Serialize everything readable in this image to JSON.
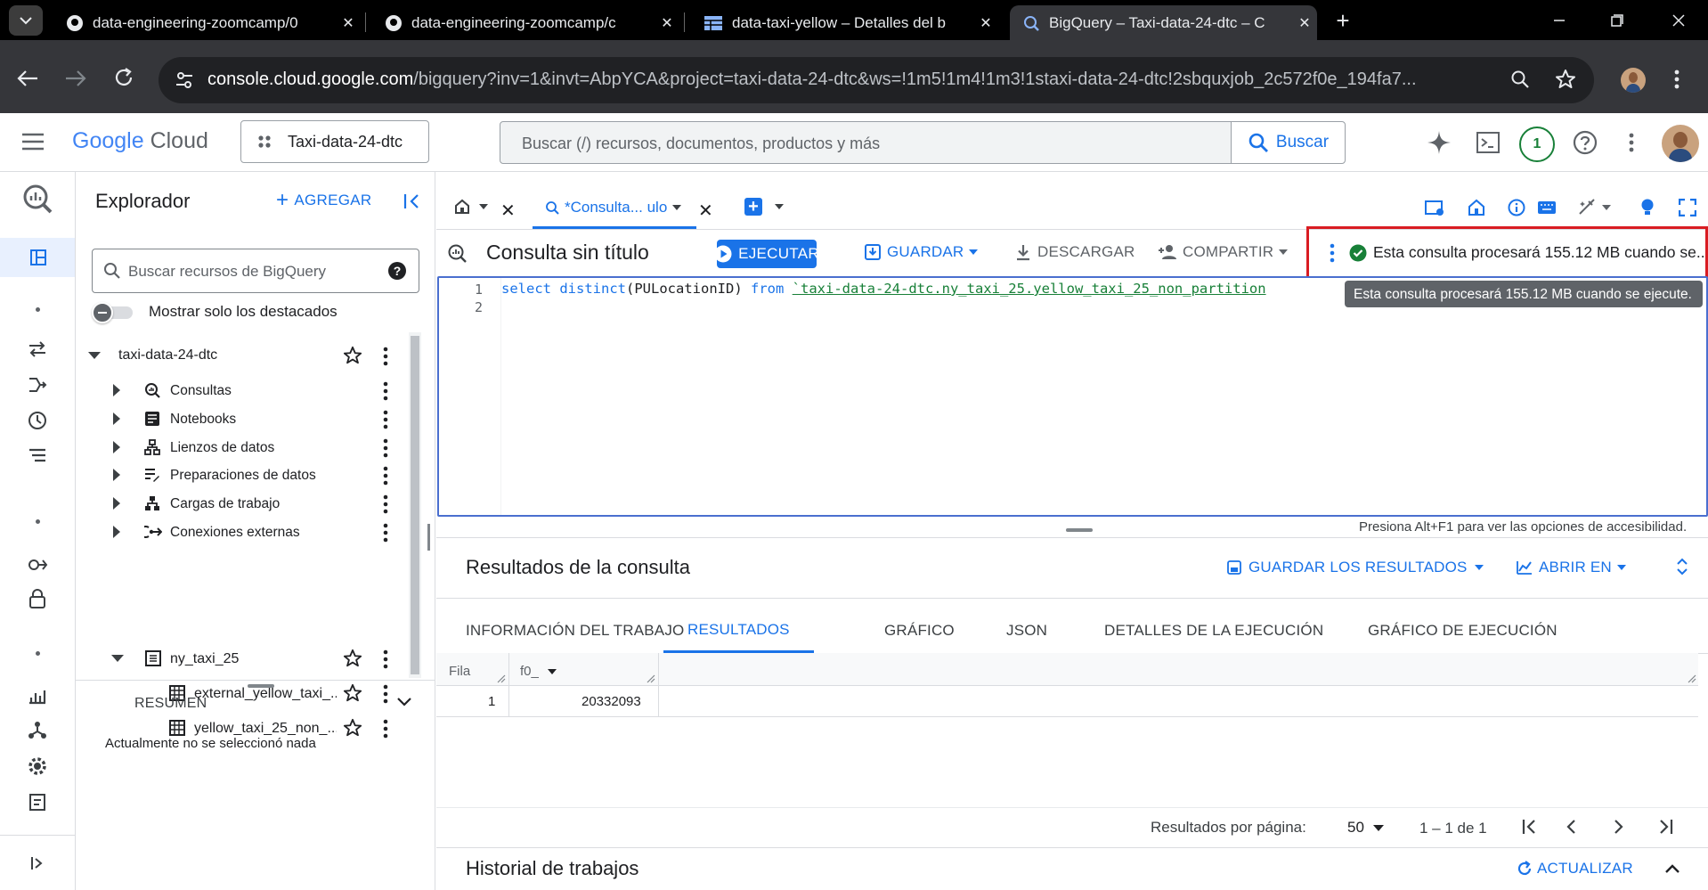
{
  "browser": {
    "tabs": [
      {
        "title": "data-engineering-zoomcamp/0",
        "icon": "github-icon"
      },
      {
        "title": "data-engineering-zoomcamp/c",
        "icon": "github-icon"
      },
      {
        "title": "data-taxi-yellow – Detalles del b",
        "icon": "table-icon"
      },
      {
        "title": "BigQuery – Taxi-data-24-dtc – C",
        "icon": "bigquery-icon",
        "active": true
      }
    ],
    "url_host": "console.cloud.google.com",
    "url_path": "/bigquery?inv=1&invt=AbpYCA&project=taxi-data-24-dtc&ws=!1m5!1m4!1m3!1staxi-data-24-dtc!2sbquxjob_2c572f0e_194fa7..."
  },
  "header": {
    "logo_google": "Google",
    "logo_cloud": "Cloud",
    "project": "Taxi-data-24-dtc",
    "search_placeholder": "Buscar (/) recursos, documentos, productos y más",
    "search_button": "Buscar",
    "notification_count": "1"
  },
  "explorer": {
    "title": "Explorador",
    "add_label": "AGREGAR",
    "search_placeholder": "Buscar recursos de BigQuery",
    "starred_toggle": "Mostrar solo los destacados",
    "project": "taxi-data-24-dtc",
    "items": [
      {
        "label": "Consultas",
        "icon": "query-icon"
      },
      {
        "label": "Notebooks",
        "icon": "notebook-icon"
      },
      {
        "label": "Lienzos de datos",
        "icon": "canvas-icon"
      },
      {
        "label": "Preparaciones de datos",
        "icon": "data-prep-icon"
      },
      {
        "label": "Cargas de trabajo",
        "icon": "workload-icon"
      },
      {
        "label": "Conexiones externas",
        "icon": "connection-icon"
      }
    ],
    "dataset": "ny_taxi_25",
    "tables": [
      "external_yellow_taxi_...",
      "yellow_taxi_25_non_..."
    ],
    "summary_title": "RESUMEN",
    "summary_text": "Actualmente no se seleccionó nada"
  },
  "editor": {
    "tab_label": "*Consulta... ulo",
    "query_title": "Consulta sin título",
    "run_label": "EJECUTAR",
    "save_label": "GUARDAR",
    "download_label": "DESCARGAR",
    "share_label": "COMPARTIR",
    "validation_text": "Esta consulta procesará 155.12 MB cuando se...",
    "tooltip_text": "Esta consulta procesará 155.12 MB cuando se ejecute.",
    "line_numbers": [
      "1",
      "2"
    ],
    "code_keyword1": "select",
    "code_keyword2": "distinct",
    "code_args": "(PULocationID)",
    "code_from": "from",
    "code_table": "`taxi-data-24-dtc.ny_taxi_25.yellow_taxi_25_non_partition",
    "accessibility_hint": "Presiona Alt+F1 para ver las opciones de accesibilidad."
  },
  "results": {
    "title": "Resultados de la consulta",
    "save_results": "GUARDAR LOS RESULTADOS",
    "open_in": "ABRIR EN",
    "tabs": [
      "INFORMACIÓN DEL TRABAJO",
      "RESULTADOS",
      "GRÁFICO",
      "JSON",
      "DETALLES DE LA EJECUCIÓN",
      "GRÁFICO DE EJECUCIÓN"
    ],
    "active_tab": "RESULTADOS",
    "columns": [
      "Fila",
      "f0_"
    ],
    "rows": [
      [
        "1",
        "20332093"
      ]
    ],
    "per_page_label": "Resultados por página:",
    "per_page_value": "50",
    "range": "1 – 1 de 1"
  },
  "history": {
    "title": "Historial de trabajos",
    "refresh": "ACTUALIZAR"
  }
}
